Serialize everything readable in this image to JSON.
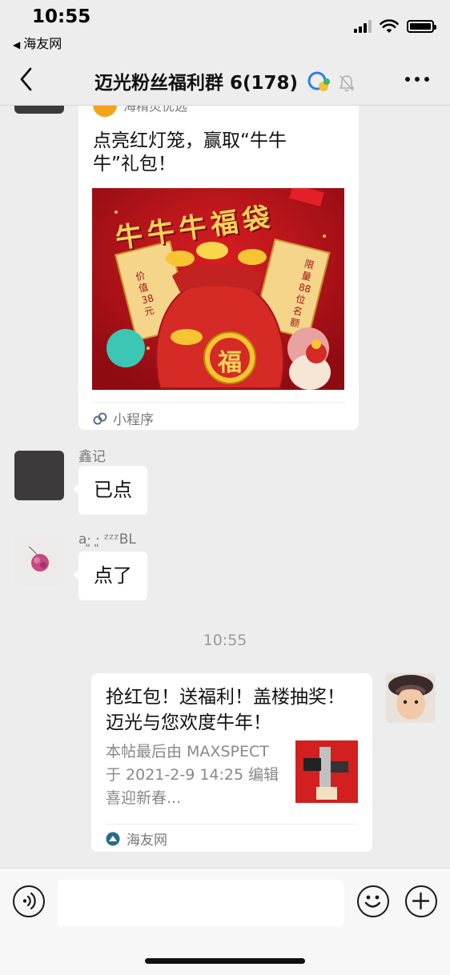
{
  "status": {
    "time": "10:55",
    "back_app": "海友网"
  },
  "header": {
    "title": "迈光粉丝福利群 6(178)"
  },
  "messages": {
    "mini_program": {
      "source": "海精灵优选",
      "text": "点亮红灯笼，赢取“牛牛牛”礼包！",
      "poster_title": "牛牛牛福袋",
      "left_tag": "价值38元",
      "right_tag": "限量88位名额",
      "seal": "福",
      "footer": "小程序"
    },
    "msg2": {
      "sender": "鑫记",
      "text": "已点"
    },
    "msg3": {
      "sender": "a·͈ ·͈ ᶻᶻᶻBL",
      "text": "点了"
    },
    "timestamp": "10:55",
    "link_card": {
      "title": "抢红包！送福利！盖楼抽奖！迈光与您欢度牛年！",
      "desc": "本帖最后由 MAXSPECT 于 2021-2-9 14:25 编辑喜迎新春...",
      "source": "海友网"
    }
  },
  "icons": {
    "back": "chevron-left-icon",
    "voice": "voice-icon",
    "emoji": "emoji-icon",
    "add": "plus-icon",
    "mute": "bell-slash-icon",
    "group": "group-chat-icon"
  },
  "colors": {
    "accent": "#d4131e",
    "bubble": "#ffffff",
    "background": "#ededed"
  }
}
